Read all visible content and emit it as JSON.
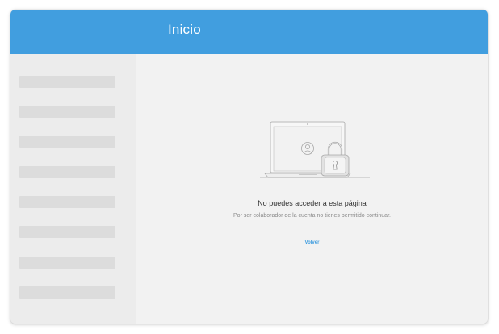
{
  "header": {
    "title": "Inicio"
  },
  "sidebar": {
    "items": [
      {
        "placeholder": true
      },
      {
        "placeholder": true
      },
      {
        "placeholder": true
      },
      {
        "placeholder": true
      },
      {
        "placeholder": true
      },
      {
        "placeholder": true
      },
      {
        "placeholder": true
      },
      {
        "placeholder": true
      }
    ]
  },
  "main": {
    "illustration_icons": [
      "laptop-icon",
      "user-avatar-icon",
      "padlock-icon"
    ],
    "message_title": "No puedes acceder a esta página",
    "message_body": "Por ser colaborador de la cuenta no tienes permitido continuar.",
    "back_label": "Volver"
  },
  "colors": {
    "accent": "#419edf",
    "background": "#f2f2f2",
    "sidebar": "#ececec",
    "placeholder": "#dcdcdc"
  }
}
